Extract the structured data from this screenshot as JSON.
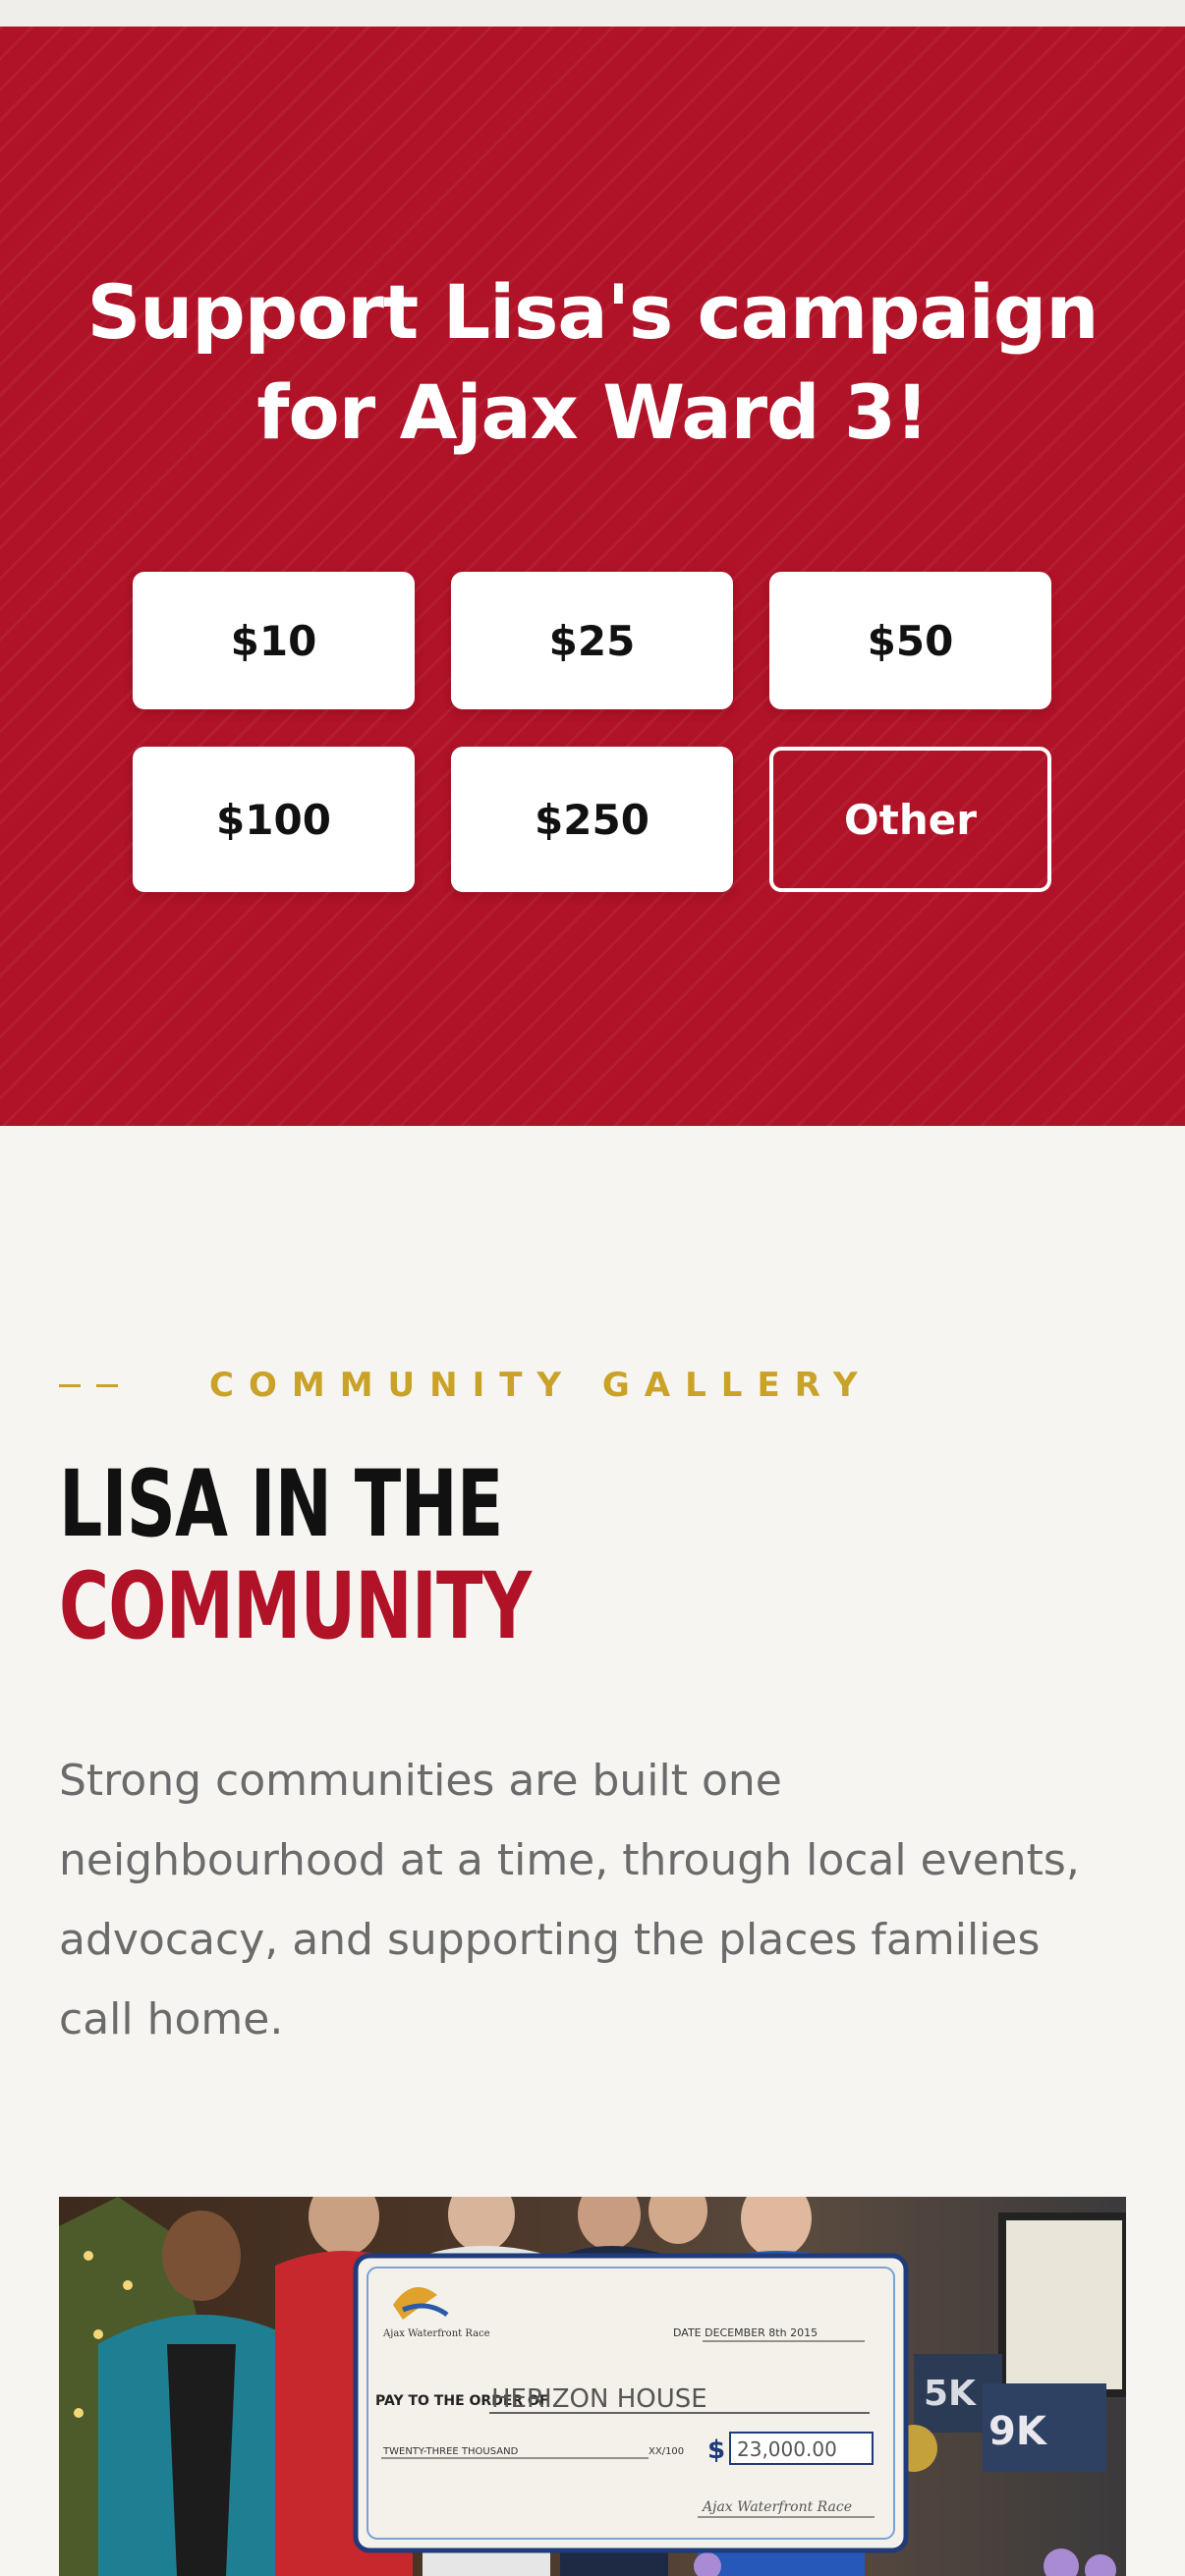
{
  "donate": {
    "title_line1": "Support Lisa's campaign",
    "title_line2": "for Ajax Ward 3!",
    "amounts": [
      "$10",
      "$25",
      "$50",
      "$100",
      "$250",
      "Other"
    ]
  },
  "gallery": {
    "eyebrow": "COMMUNITY GALLERY",
    "title_line1": "LISA IN THE",
    "title_line2": "COMMUNITY",
    "description": "Strong communities are built one neighbourhood at a time, through local events, advocacy, and supporting the places families call home."
  },
  "photo": {
    "cheque_org": "Ajax Waterfront Race",
    "cheque_date": "DATE DECEMBER 8th 2015",
    "cheque_pay_label": "PAY TO THE ORDER OF",
    "cheque_payee": "HERIZON HOUSE",
    "cheque_amount_words": "TWENTY-THREE THOUSAND",
    "cheque_cents": "XX/100",
    "cheque_dollar_sign": "$",
    "cheque_amount": "23,000.00",
    "cheque_signature": "Ajax Waterfront Race",
    "sign_5k": "5K",
    "sign_9k": "9K"
  },
  "colors": {
    "brand_red": "#b01227",
    "gold": "#c9a227",
    "page_bg": "#f6f5f2"
  }
}
